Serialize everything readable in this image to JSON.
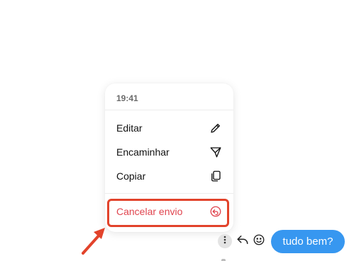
{
  "menu": {
    "time": "19:41",
    "items": [
      {
        "label": "Editar",
        "icon": "pencil-icon"
      },
      {
        "label": "Encaminhar",
        "icon": "send-icon"
      },
      {
        "label": "Copiar",
        "icon": "copy-icon"
      }
    ],
    "unsend": {
      "label": "Cancelar envio",
      "icon": "undo-circle-icon"
    }
  },
  "message": {
    "text": "tudo bem?"
  },
  "actions": {
    "more_icon": "more-vertical-icon",
    "reply_icon": "reply-icon",
    "emoji_icon": "smiley-icon"
  },
  "colors": {
    "danger": "#e0454f",
    "bubble": "#3797f0",
    "annotation": "#e2432b"
  }
}
